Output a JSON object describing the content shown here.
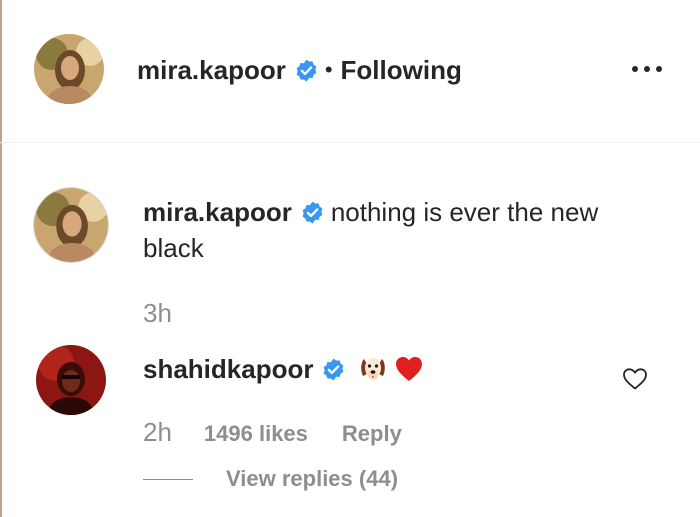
{
  "header": {
    "username": "mira.kapoor",
    "separator": "•",
    "follow_status": "Following",
    "verified": true
  },
  "caption": {
    "username": "mira.kapoor",
    "verified": true,
    "text": "nothing is ever the new black",
    "time": "3h"
  },
  "comment": {
    "username": "shahidkapoor",
    "verified": true,
    "emojis": [
      "dog-face-icon",
      "red-heart-icon"
    ],
    "time": "2h",
    "likes": "1496 likes",
    "reply_label": "Reply",
    "view_replies": "View replies (44)"
  },
  "colors": {
    "verified_blue": "#3897f0",
    "secondary_text": "#8e8e8e",
    "primary_text": "#262626",
    "heart_red": "#e0201f"
  }
}
